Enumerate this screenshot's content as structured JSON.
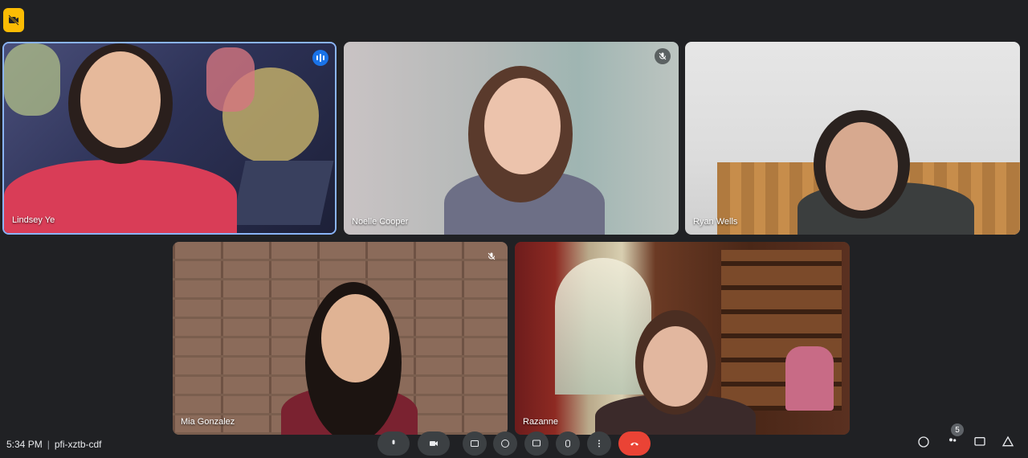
{
  "participants": [
    {
      "name": "Lindsey Ye",
      "status": "speaking"
    },
    {
      "name": "Noelle Cooper",
      "status": "muted"
    },
    {
      "name": "Ryan Wells",
      "status": "none"
    },
    {
      "name": "Mia Gonzalez",
      "status": "muted"
    },
    {
      "name": "Razanne",
      "status": "none"
    }
  ],
  "footer": {
    "time": "5:34 PM",
    "separator": "|",
    "meeting_code": "pfi-xztb-cdf",
    "people_count": "5"
  },
  "colors": {
    "background": "#202124",
    "active_border": "#8ab4f8",
    "end_call": "#ea4335",
    "badge": "#fbbc04"
  }
}
